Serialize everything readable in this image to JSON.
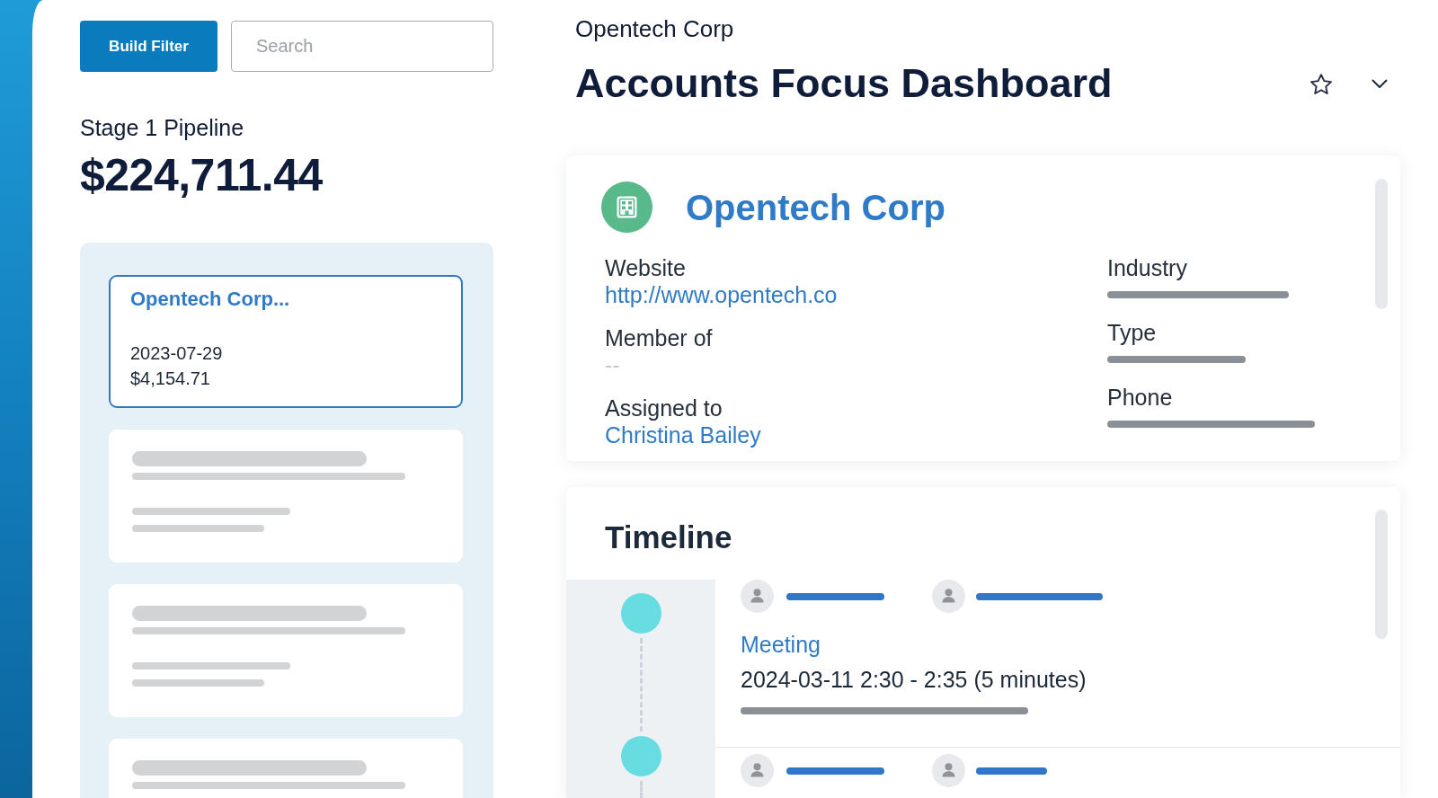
{
  "toolbar": {
    "button": "Build Filter",
    "search": {
      "placeholder": "Search"
    }
  },
  "pipeline": {
    "label": "Stage 1 Pipeline",
    "total": "$224,711.44"
  },
  "accounts": [
    {
      "kind": "account",
      "name": "Opentech Corp...",
      "date": "2023-07-29",
      "amount": "$4,154.71",
      "selected": true
    },
    {
      "kind": "placeholder",
      "selected": false
    },
    {
      "kind": "placeholder",
      "selected": false
    },
    {
      "kind": "placeholder",
      "selected": false
    }
  ],
  "header": {
    "breadcrumb": "Opentech Corp",
    "title": "Accounts Focus Dashboard"
  },
  "account_card": {
    "name": "Opentech Corp",
    "columns": [
      {
        "fields": [
          {
            "label": "Website",
            "value": "http://www.opentech.co",
            "kind": "link"
          },
          {
            "label": "Member of",
            "value": "--",
            "kind": "muted"
          },
          {
            "label": "Assigned to",
            "value": "Christina Bailey",
            "kind": "link"
          }
        ]
      },
      {
        "fields": [
          {
            "label": "Industry",
            "kind": "placeholder"
          },
          {
            "label": "Type",
            "kind": "placeholder"
          },
          {
            "label": "Phone",
            "kind": "placeholder"
          }
        ]
      }
    ]
  },
  "timeline": {
    "title": "Timeline",
    "entries": [
      {
        "kind": "event",
        "title": "Meeting",
        "time": "2024-03-11 2:30 - 2:35 (5 minutes)"
      },
      {
        "kind": "stub"
      }
    ]
  }
}
